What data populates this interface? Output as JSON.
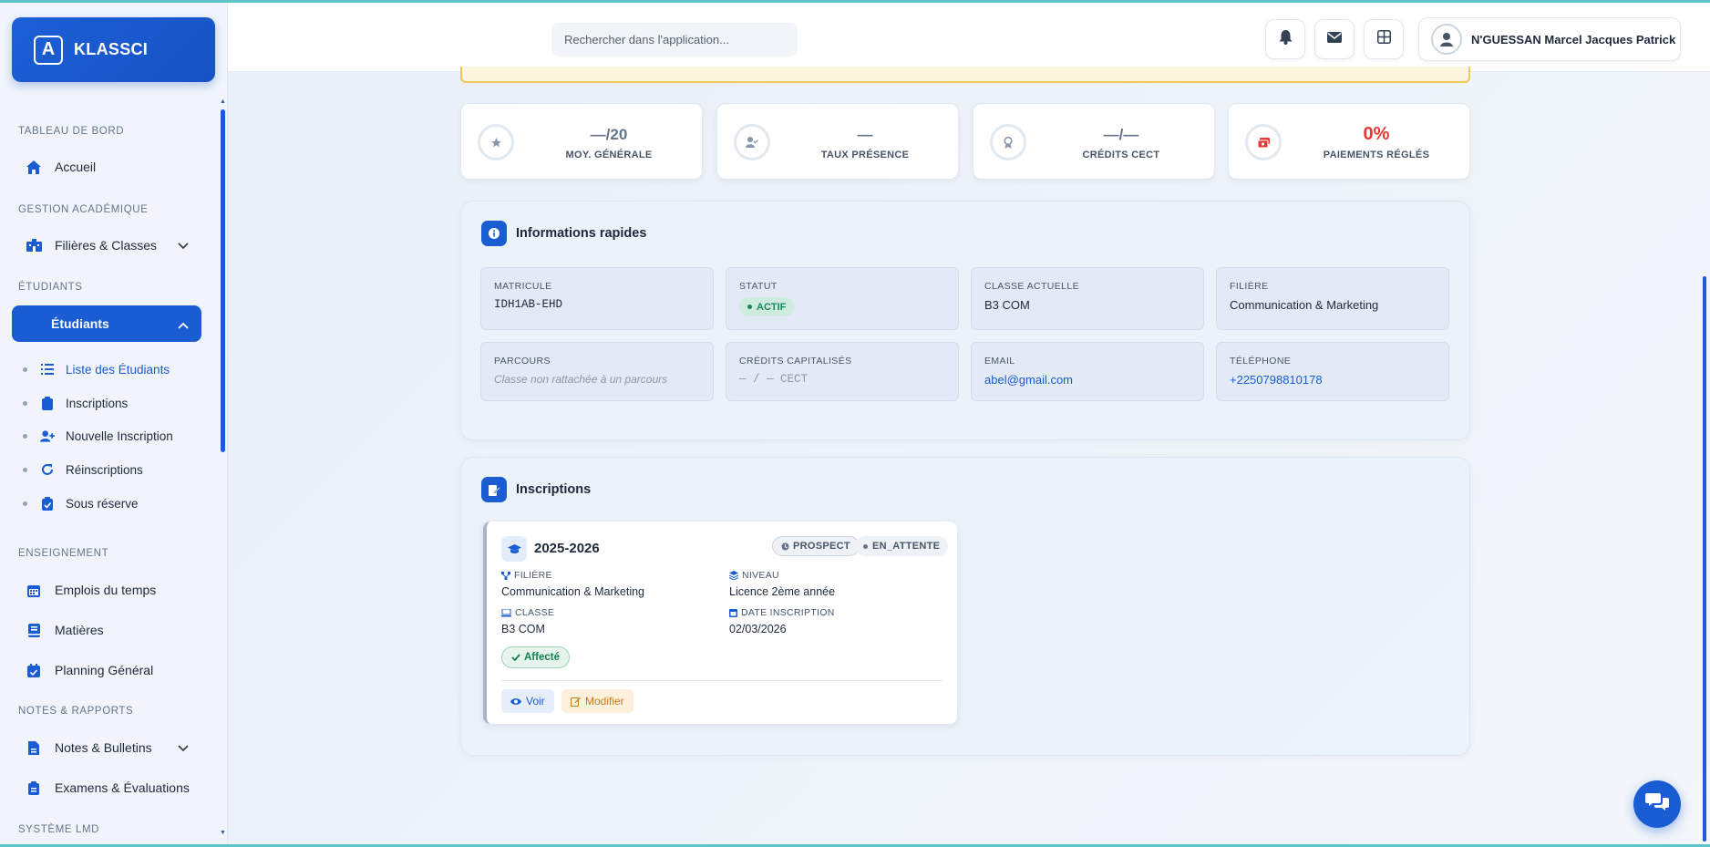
{
  "app": {
    "name": "KLASSCI"
  },
  "header": {
    "search_placeholder": "Rechercher dans l'application...",
    "user_name": "N'GUESSAN Marcel Jacques Patrick"
  },
  "sidebar": {
    "sections": {
      "dashboard": "TABLEAU DE BORD",
      "academic": "GESTION ACADÉMIQUE",
      "students": "ÉTUDIANTS",
      "teaching": "ENSEIGNEMENT",
      "notes": "NOTES & RAPPORTS",
      "lmd": "SYSTÈME LMD"
    },
    "items": {
      "accueil": "Accueil",
      "filieres": "Filières & Classes",
      "etudiants": "Étudiants",
      "liste": "Liste des Étudiants",
      "inscriptions": "Inscriptions",
      "nouvelle": "Nouvelle Inscription",
      "reinscriptions": "Réinscriptions",
      "sous_reserve": "Sous réserve",
      "emplois": "Emplois du temps",
      "matieres": "Matières",
      "planning": "Planning Général",
      "notes_bulletins": "Notes & Bulletins",
      "examens": "Examens & Évaluations"
    }
  },
  "stats": [
    {
      "value": "—/20",
      "label": "MOY. GÉNÉRALE",
      "icon": "star-icon"
    },
    {
      "value": "—",
      "label": "TAUX PRÉSENCE",
      "icon": "user-check-icon"
    },
    {
      "value": "—/—",
      "label": "CRÉDITS CECT",
      "icon": "award-icon"
    },
    {
      "value": "0%",
      "label": "PAIEMENTS RÉGLÉS",
      "icon": "money-icon",
      "color": "#e53935"
    }
  ],
  "quick_info": {
    "title": "Informations rapides",
    "matricule_label": "MATRICULE",
    "matricule": "IDH1AB-EHD",
    "statut_label": "STATUT",
    "statut": "ACTIF",
    "classe_label": "CLASSE ACTUELLE",
    "classe": "B3 COM",
    "filiere_label": "FILIÈRE",
    "filiere": "Communication & Marketing",
    "parcours_label": "PARCOURS",
    "parcours": "Classe non rattachée à un parcours",
    "credits_label": "CRÉDITS CAPITALISÉS",
    "credits": "— / — CECT",
    "email_label": "EMAIL",
    "email": "abel@gmail.com",
    "tel_label": "TÉLÉPHONE",
    "tel": "+2250798810178"
  },
  "inscriptions": {
    "title": "Inscriptions",
    "card": {
      "year": "2025-2026",
      "badge_type": "PROSPECT",
      "badge_status": "EN_ATTENTE",
      "filiere_label": "FILIÈRE",
      "filiere": "Communication & Marketing",
      "niveau_label": "NIVEAU",
      "niveau": "Licence 2ème année",
      "classe_label": "CLASSE",
      "classe": "B3 COM",
      "date_label": "DATE INSCRIPTION",
      "date": "02/03/2026",
      "affecte": "Affecté",
      "voir": "Voir",
      "modifier": "Modifier"
    }
  },
  "colors": {
    "primary": "#1a5cd1",
    "success": "#138a5b",
    "danger": "#e53935",
    "warning": "#f0c75a"
  }
}
